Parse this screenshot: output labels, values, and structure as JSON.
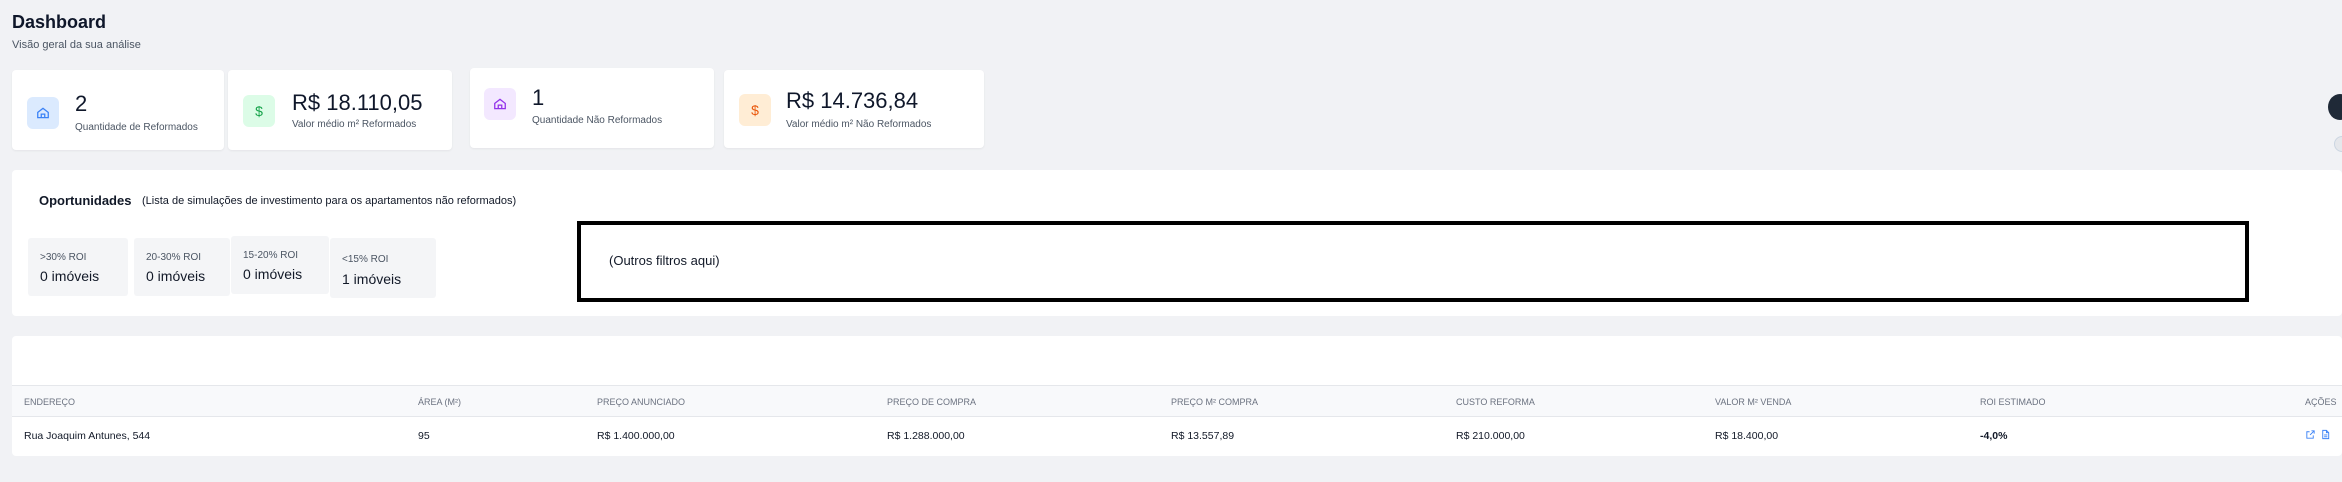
{
  "header": {
    "title": "Dashboard",
    "subtitle": "Visão geral da sua análise"
  },
  "kpis": [
    {
      "value": "2",
      "label": "Quantidade de Reformados",
      "icon": "home-icon",
      "color": "#3b82f6"
    },
    {
      "value": "R$ 18.110,05",
      "label": "Valor médio m² Reformados",
      "icon": "dollar-icon",
      "color": "#16a34a"
    },
    {
      "value": "1",
      "label": "Quantidade Não Reformados",
      "icon": "home-icon",
      "color": "#9333ea"
    },
    {
      "value": "R$ 14.736,84",
      "label": "Valor médio m² Não Reformados",
      "icon": "dollar-icon",
      "color": "#ea580c"
    }
  ],
  "opportunities": {
    "title": "Oportunidades",
    "description": "(Lista de simulações de investimento para os apartamentos não reformados)",
    "roi_filters": [
      {
        "label": ">30% ROI",
        "count": "0 imóveis"
      },
      {
        "label": "20-30% ROI",
        "count": "0 imóveis"
      },
      {
        "label": "15-20% ROI",
        "count": "0 imóveis"
      },
      {
        "label": "<15% ROI",
        "count": "1 imóveis"
      }
    ],
    "other_filters": "(Outros filtros aqui)"
  },
  "table": {
    "headers": [
      "ENDEREÇO",
      "ÁREA (M²)",
      "PREÇO ANUNCIADO",
      "PREÇO DE COMPRA",
      "PREÇO M² COMPRA",
      "CUSTO REFORMA",
      "VALOR M² VENDA",
      "ROI ESTIMADO",
      "AÇÕES"
    ],
    "rows": [
      {
        "endereco": "Rua Joaquim Antunes, 544",
        "area": "95",
        "preco_anunciado": "R$ 1.400.000,00",
        "preco_compra": "R$ 1.288.000,00",
        "preco_m2_compra": "R$ 13.557,89",
        "custo_reforma": "R$ 210.000,00",
        "valor_m2_venda": "R$ 18.400,00",
        "roi": "-4,0%"
      }
    ]
  },
  "colors": {
    "accent_blue": "#3b82f6",
    "action_icon": "#3b82f6"
  }
}
